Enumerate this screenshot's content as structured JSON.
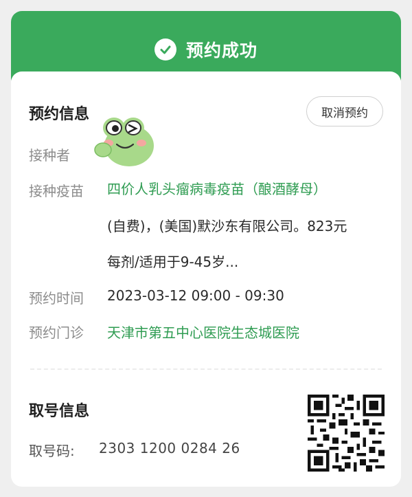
{
  "header": {
    "title": "预约成功"
  },
  "booking": {
    "section_title": "预约信息",
    "cancel_label": "取消预约",
    "recipient_label": "接种者",
    "vaccine_label": "接种疫苗",
    "vaccine_line1": "四价人乳头瘤病毒疫苗（酿酒酵母）",
    "vaccine_line2": "(自费)，(美国)默沙东有限公司。823元",
    "vaccine_line3": "每剂/适用于9-45岁...",
    "time_label": "预约时间",
    "time_value": "2023-03-12 09:00 - 09:30",
    "clinic_label": "预约门诊",
    "clinic_value": "天津市第五中心医院生态城医院"
  },
  "ticket": {
    "section_title": "取号信息",
    "number_label": "取号码:",
    "number_value": "2303 1200 0284 26"
  },
  "colors": {
    "accent": "#3aaa5c",
    "green_text": "#2f9c52"
  },
  "icons": {
    "success": "check-circle-icon",
    "sticker": "frog-sticker",
    "code": "qr-code"
  }
}
